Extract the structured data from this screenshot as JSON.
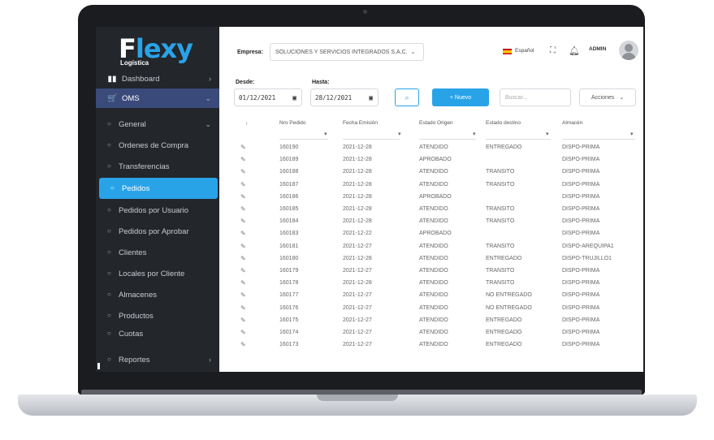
{
  "colors": {
    "accent": "#29a3e8",
    "sidebar": "#23262b",
    "oms_highlight": "#3a4a7a"
  },
  "logo": {
    "main": "Flexy",
    "sub": "Logística"
  },
  "sidebar": {
    "items": [
      {
        "label": "Dashboard",
        "icon": "dashboard-icon"
      },
      {
        "label": "OMS",
        "icon": "cart-icon"
      },
      {
        "label": "General"
      },
      {
        "label": "Ordenes de Compra"
      },
      {
        "label": "Transferencias"
      },
      {
        "label": "Pedidos"
      },
      {
        "label": "Pedidos por Usuario"
      },
      {
        "label": "Pedidos por Aprobar"
      },
      {
        "label": "Clientes"
      },
      {
        "label": "Locales por Cliente"
      },
      {
        "label": "Almacenes"
      },
      {
        "label": "Productos"
      },
      {
        "label": "Cuotas"
      },
      {
        "label": "Reportes"
      }
    ]
  },
  "header": {
    "empresa_label": "Empresa:",
    "empresa_value": "SOLUCIONES Y SERVICIOS INTEGRADOS S.A.C.",
    "language": "Español",
    "user": "ADMIN"
  },
  "filters": {
    "desde_label": "Desde:",
    "desde_value": "01/12/2021",
    "hasta_label": "Hasta:",
    "hasta_value": "28/12/2021",
    "new_button": "+ Nuevo",
    "search_placeholder": "Buscar...",
    "actions_label": "Acciones"
  },
  "table": {
    "headers": [
      "Nro Pedido",
      "Fecha Emisión",
      "Estado Origen",
      "Estado destino",
      "Almacén"
    ],
    "rows": [
      [
        "160190",
        "2021-12-28",
        "ATENDIDO",
        "ENTREGADO",
        "DISPO-PRIMA"
      ],
      [
        "160189",
        "2021-12-28",
        "APROBADO",
        "",
        "DISPO-PRIMA"
      ],
      [
        "160188",
        "2021-12-28",
        "ATENDIDO",
        "TRANSITO",
        "DISPO-PRIMA"
      ],
      [
        "160187",
        "2021-12-28",
        "ATENDIDO",
        "TRANSITO",
        "DISPO-PRIMA"
      ],
      [
        "160186",
        "2021-12-28",
        "APROBADO",
        "",
        "DISPO-PRIMA"
      ],
      [
        "160185",
        "2021-12-28",
        "ATENDIDO",
        "TRANSITO",
        "DISPO-PRIMA"
      ],
      [
        "160184",
        "2021-12-28",
        "ATENDIDO",
        "TRANSITO",
        "DISPO-PRIMA"
      ],
      [
        "160183",
        "2021-12-22",
        "APROBADO",
        "",
        "DISPO-PRIMA"
      ],
      [
        "160181",
        "2021-12-27",
        "ATENDIDO",
        "TRANSITO",
        "DISPO-AREQUIPA1"
      ],
      [
        "160180",
        "2021-12-28",
        "ATENDIDO",
        "ENTREGADO",
        "DISPO-TRUJILLO1"
      ],
      [
        "160179",
        "2021-12-27",
        "ATENDIDO",
        "TRANSITO",
        "DISPO-PRIMA"
      ],
      [
        "160178",
        "2021-12-28",
        "ATENDIDO",
        "TRANSITO",
        "DISPO-PRIMA"
      ],
      [
        "160177",
        "2021-12-27",
        "ATENDIDO",
        "NO ENTREGADO",
        "DISPO-PRIMA"
      ],
      [
        "160176",
        "2021-12-27",
        "ATENDIDO",
        "NO ENTREGADO",
        "DISPO-PRIMA"
      ],
      [
        "160175",
        "2021-12-27",
        "ATENDIDO",
        "ENTREGADO",
        "DISPO-PRIMA"
      ],
      [
        "160174",
        "2021-12-27",
        "ATENDIDO",
        "ENTREGADO",
        "DISPO-PRIMA"
      ],
      [
        "160173",
        "2021-12-27",
        "ATENDIDO",
        "ENTREGADO",
        "DISPO-PRIMA"
      ]
    ]
  }
}
